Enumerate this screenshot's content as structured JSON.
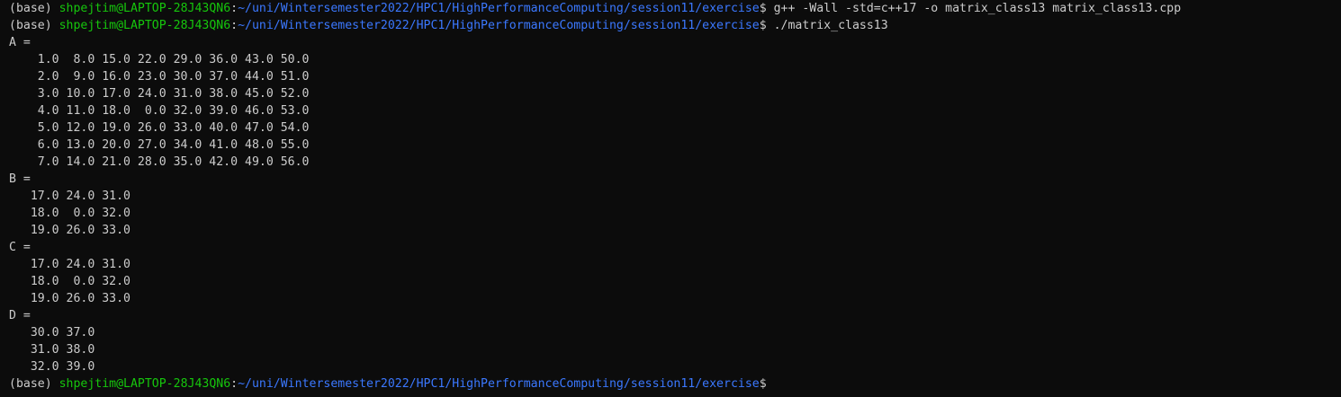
{
  "terminal": {
    "colors": {
      "background": "#0c0c0c",
      "foreground": "#cccccc",
      "user_host": "#16c60c",
      "path": "#3b78ff"
    },
    "prompt": {
      "env": "(base)",
      "user_host": "shpejtim@LAPTOP-28J43QN6",
      "sep": ":",
      "path": "~/uni/Wintersemester2022/HPC1/HighPerformanceComputing/session11/exercise",
      "symbol": "$"
    },
    "commands": [
      "g++ -Wall -std=c++17 -o matrix_class13 matrix_class13.cpp",
      "./matrix_class13"
    ],
    "output": [
      "A =",
      "    1.0  8.0 15.0 22.0 29.0 36.0 43.0 50.0",
      "    2.0  9.0 16.0 23.0 30.0 37.0 44.0 51.0",
      "    3.0 10.0 17.0 24.0 31.0 38.0 45.0 52.0",
      "    4.0 11.0 18.0  0.0 32.0 39.0 46.0 53.0",
      "    5.0 12.0 19.0 26.0 33.0 40.0 47.0 54.0",
      "    6.0 13.0 20.0 27.0 34.0 41.0 48.0 55.0",
      "    7.0 14.0 21.0 28.0 35.0 42.0 49.0 56.0",
      "B =",
      "   17.0 24.0 31.0",
      "   18.0  0.0 32.0",
      "   19.0 26.0 33.0",
      "C =",
      "   17.0 24.0 31.0",
      "   18.0  0.0 32.0",
      "   19.0 26.0 33.0",
      "D =",
      "   30.0 37.0",
      "   31.0 38.0",
      "   32.0 39.0"
    ]
  }
}
